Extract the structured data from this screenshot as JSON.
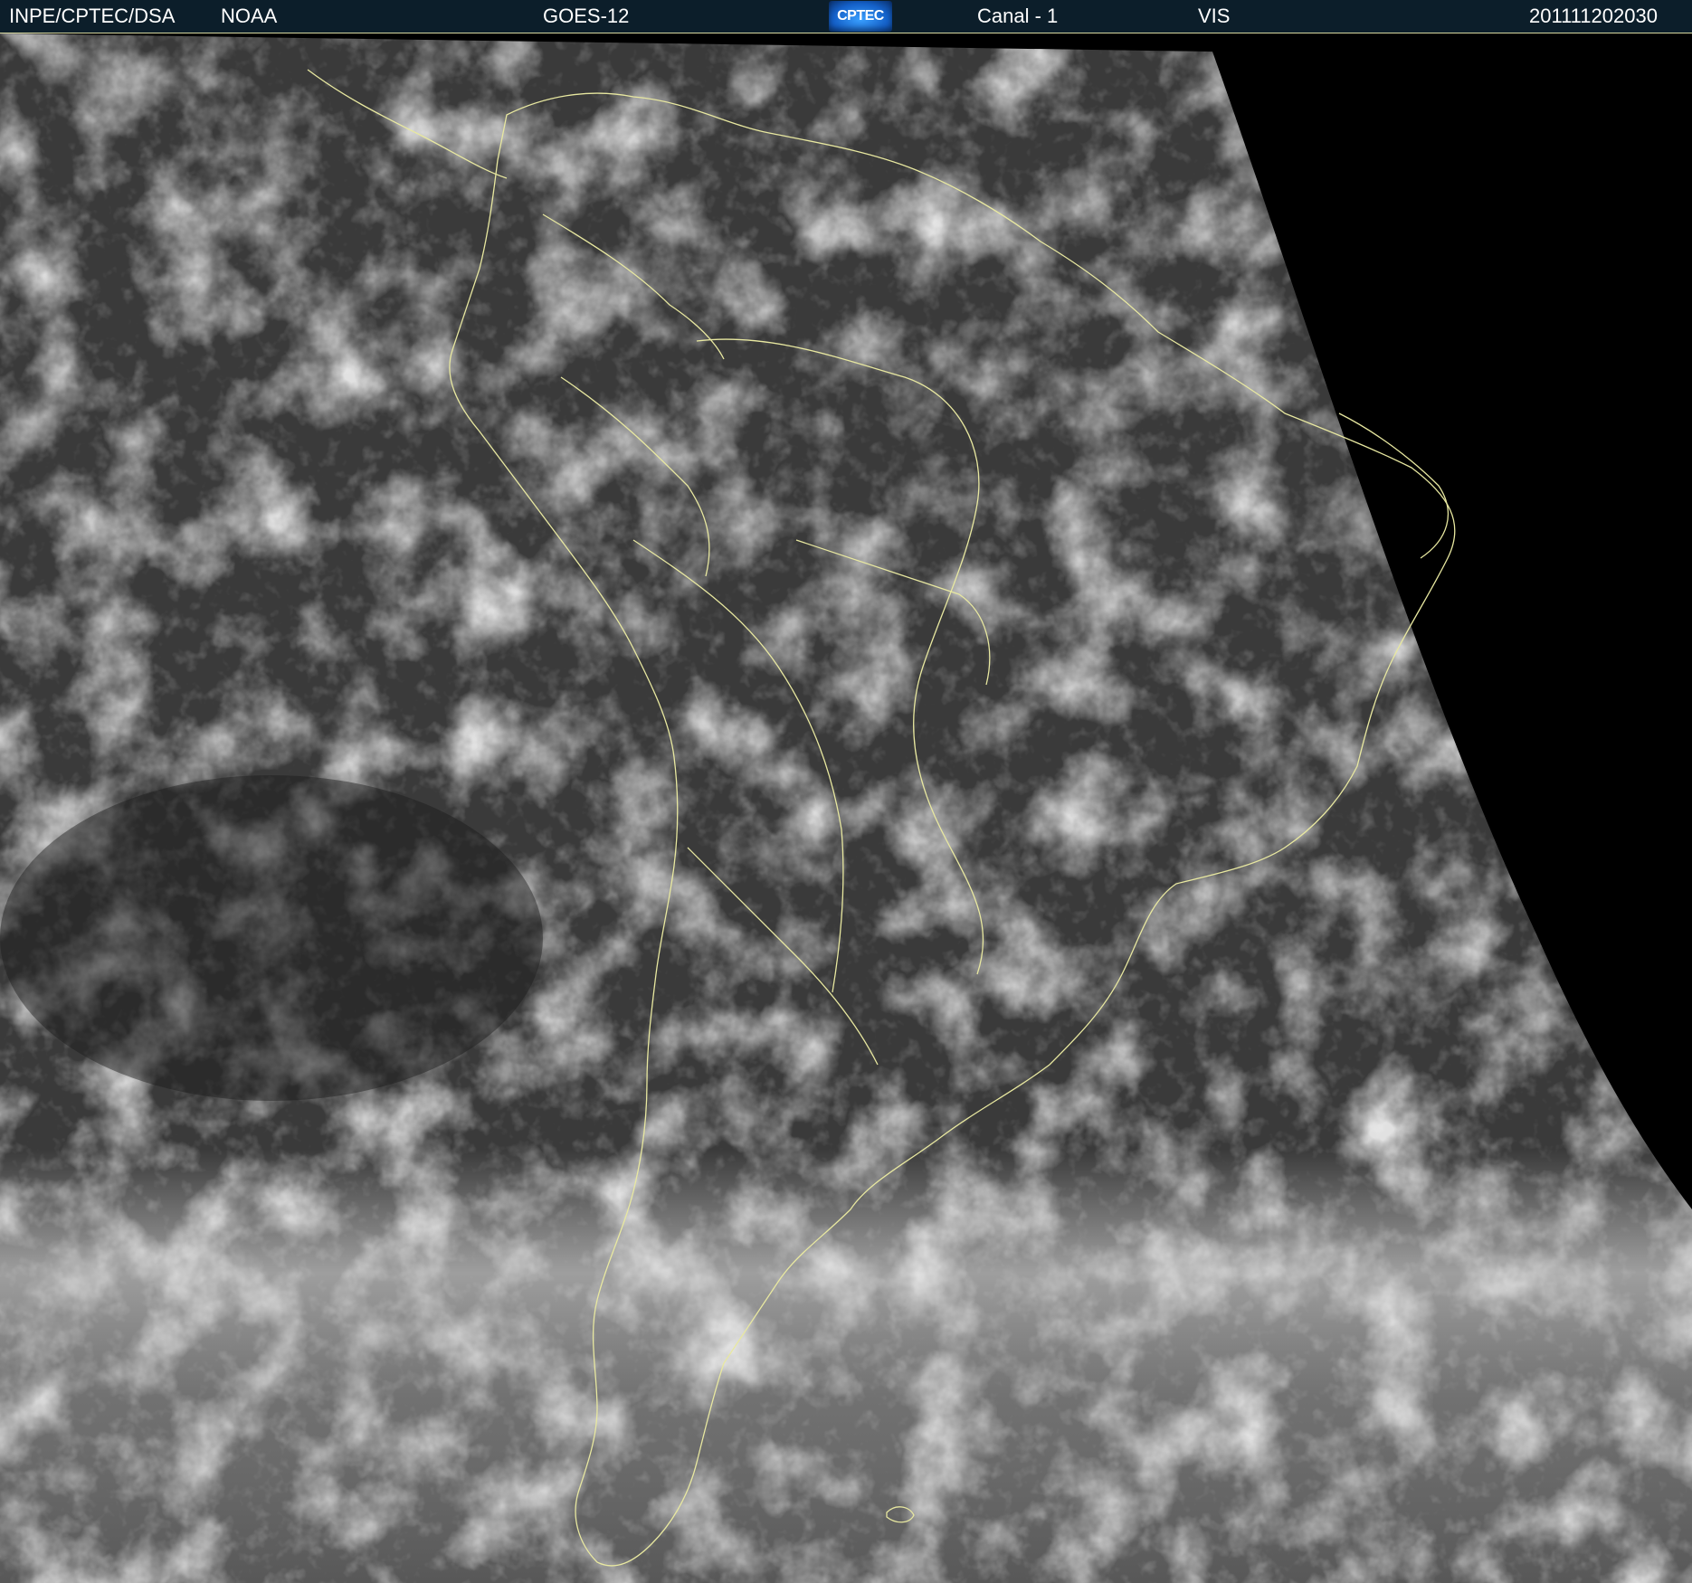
{
  "header": {
    "agency": "INPE/CPTEC/DSA",
    "source": "NOAA",
    "satellite": "GOES-12",
    "logo_text": "CPTEC",
    "channel": "Canal - 1",
    "band": "VIS",
    "timestamp": "201111202030"
  },
  "image": {
    "subject": "satellite-visible-image-south-america",
    "colors": {
      "header_bg": "#0c1e2a",
      "coastline": "#e8e8a0",
      "ocean": "#2a2a2a",
      "space": "#000000",
      "cloud": "#e8e8e8"
    }
  }
}
